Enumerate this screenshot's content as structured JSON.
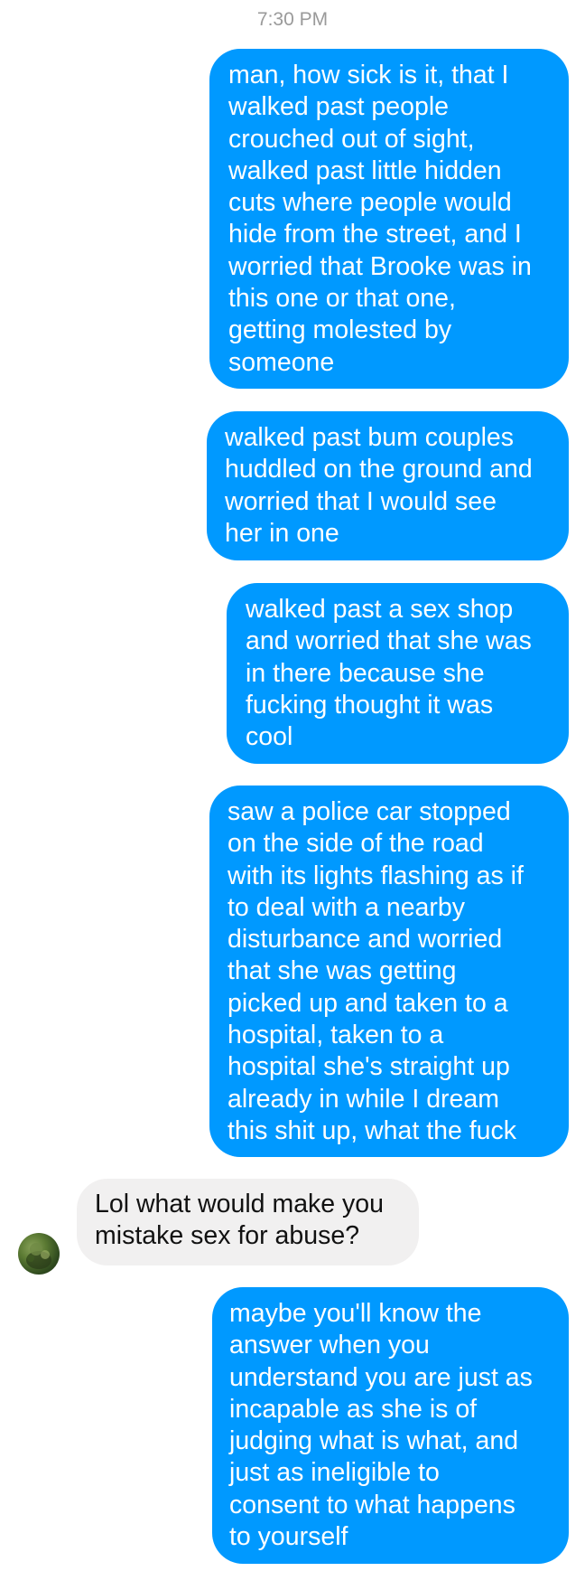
{
  "conversation": {
    "timestamp": "7:30 PM",
    "messages": [
      {
        "direction": "outgoing",
        "text": "man, how sick is it, that I\nwalked past people\ncrouched out of sight,\nwalked past little hidden\ncuts where people would\nhide from the street, and I\nworried that Brooke was in\nthis one or that one,\ngetting molested by\nsomeone"
      },
      {
        "direction": "outgoing",
        "text": "walked past bum couples\nhuddled on the ground and\nworried that I would see\nher in one"
      },
      {
        "direction": "outgoing",
        "text": "walked past a sex shop\nand worried that she was\nin there because she\nfucking thought it was\ncool"
      },
      {
        "direction": "outgoing",
        "text": "saw a police car stopped\non the side of the road\nwith its lights flashing as if\nto deal with a nearby\ndisturbance and worried\nthat she was getting\npicked up and taken to a\nhospital, taken to a\nhospital she's straight up\nalready in while I dream\nthis shit up, what the fuck"
      },
      {
        "direction": "incoming",
        "text": "Lol what would make you\nmistake sex for abuse?"
      },
      {
        "direction": "outgoing",
        "text": "maybe you'll know the\nanswer when you\nunderstand you are just as\nincapable as she is of\njudging what is what, and\njust as ineligible to\nconsent to what happens\nto yourself"
      }
    ]
  },
  "colors": {
    "outgoing_bubble": "#0099ff",
    "incoming_bubble": "#f1f0f0",
    "timestamp_text": "#9a9a9a"
  },
  "icons": {
    "avatar": "contact-avatar-photo"
  }
}
